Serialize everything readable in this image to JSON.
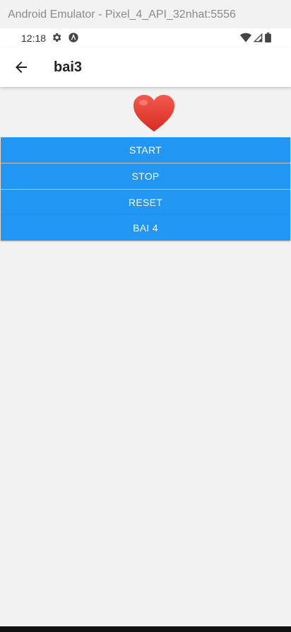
{
  "emulator": {
    "title": "Android Emulator - Pixel_4_API_32nhat:5556"
  },
  "status_bar": {
    "time": "12:18",
    "icons": [
      "gear-icon",
      "a-icon",
      "wifi-icon",
      "signal-icon",
      "battery-icon"
    ]
  },
  "app_bar": {
    "title": "bai3",
    "back_icon": "arrow-back-icon"
  },
  "content": {
    "heart_icon": "heart-icon",
    "heart_color": "#e53935",
    "buttons": [
      {
        "label": "START"
      },
      {
        "label": "STOP"
      },
      {
        "label": "RESET"
      },
      {
        "label": "BAI 4"
      }
    ],
    "button_color": "#2196f3"
  }
}
